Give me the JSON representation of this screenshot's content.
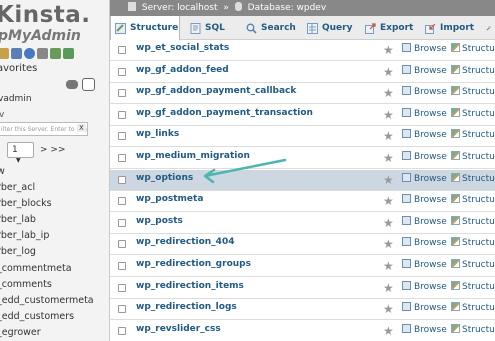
{
  "sidebar": {
    "logo_line1": "Kinsta.",
    "logo_line2": "pMyAdmin",
    "favorites": "avorites",
    "db_name": "vadmin",
    "filter_placeholder": "ilter this Server. Enter to search",
    "filter_clear": "X",
    "page_value": "1",
    "page_next": "> >>",
    "items": [
      "w",
      "rber_acl",
      "rber_blocks",
      "rber_lab",
      "rber_lab_ip",
      "rber_log",
      "_commentmeta",
      "_comments",
      "_edd_customermeta",
      "_edd_customers",
      "_egrower"
    ]
  },
  "breadcrumb": {
    "server": "Server: localhost",
    "sep": "»",
    "database": "Database: wpdev"
  },
  "tabs": [
    {
      "label": "Structure",
      "active": true
    },
    {
      "label": "SQL",
      "active": false
    },
    {
      "label": "Search",
      "active": false
    },
    {
      "label": "Query",
      "active": false
    },
    {
      "label": "Export",
      "active": false
    },
    {
      "label": "Import",
      "active": false
    }
  ],
  "actions": {
    "browse": "Browse",
    "structure": "Structu"
  },
  "tables": [
    "wp_et_social_stats",
    "wp_gf_addon_feed",
    "wp_gf_addon_payment_callback",
    "wp_gf_addon_payment_transaction",
    "wp_links",
    "wp_medium_migration",
    "wp_options",
    "wp_postmeta",
    "wp_posts",
    "wp_redirection_404",
    "wp_redirection_groups",
    "wp_redirection_items",
    "wp_redirection_logs",
    "wp_revslider_css"
  ],
  "highlighted_table": "wp_options",
  "colors": {
    "link": "#235a81",
    "highlight_row": "#cdd7e2",
    "arrow": "#4fb5b0",
    "serverbar": "#888888"
  }
}
